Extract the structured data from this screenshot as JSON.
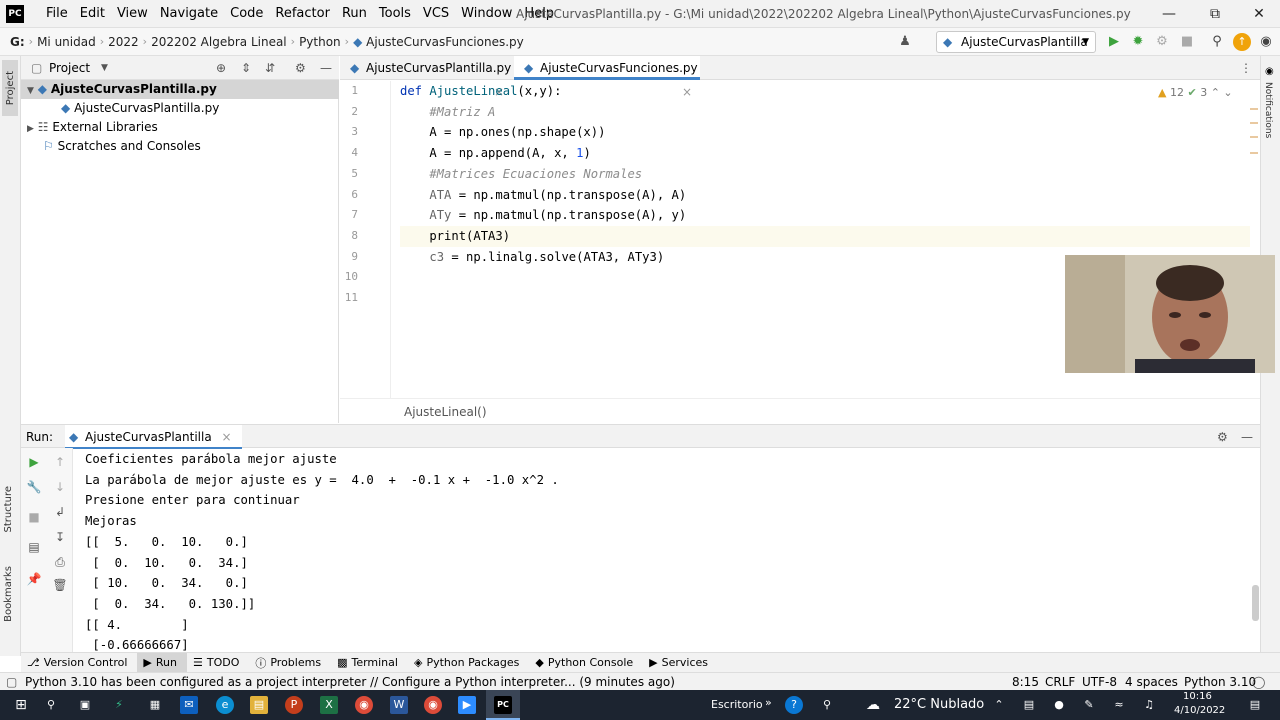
{
  "titlebar": {
    "menu": [
      "File",
      "Edit",
      "View",
      "Navigate",
      "Code",
      "Refactor",
      "Run",
      "Tools",
      "VCS",
      "Window",
      "Help"
    ],
    "title": "AjusteCurvasPlantilla.py - G:\\Mi unidad\\2022\\202202 Algebra Lineal\\Python\\AjusteCurvasFunciones.py"
  },
  "navbar": {
    "crumbs": [
      "G:",
      "Mi unidad",
      "2022",
      "202202 Algebra Lineal",
      "Python",
      "AjusteCurvasFunciones.py"
    ],
    "run_config": "AjusteCurvasPlantilla"
  },
  "project": {
    "header": "Project",
    "items": [
      "AjusteCurvasPlantilla.py",
      "AjusteCurvasPlantilla.py",
      "External Libraries",
      "Scratches and Consoles"
    ]
  },
  "left_strip": {
    "project": "Project",
    "structure": "Structure",
    "bookmarks": "Bookmarks"
  },
  "right_strip": {
    "notifications": "Notifications"
  },
  "editor": {
    "tabs": [
      "AjusteCurvasPlantilla.py",
      "AjusteCurvasFunciones.py"
    ],
    "warnings": "12",
    "weak_warnings": "3",
    "line_numbers": [
      "1",
      "2",
      "3",
      "4",
      "5",
      "6",
      "7",
      "8",
      "9",
      "10",
      "11"
    ],
    "breadcrumb": "AjusteLineal()"
  },
  "run": {
    "label": "Run:",
    "config": "AjusteCurvasPlantilla",
    "output": [
      "Coeficientes parábola mejor ajuste",
      "La parábola de mejor ajuste es y =  4.0  +  -0.1 x +  -1.0 x^2 .",
      "Presione enter para continuar",
      "Mejoras",
      "[[  5.   0.  10.   0.]",
      " [  0.  10.   0.  34.]",
      " [ 10.   0.  34.   0.]",
      " [  0.  34.   0. 130.]]",
      "[[ 4.        ]",
      " [-0.66666667]"
    ]
  },
  "bottom_tabs": [
    "Version Control",
    "Run",
    "TODO",
    "Problems",
    "Terminal",
    "Python Packages",
    "Python Console",
    "Services"
  ],
  "status": {
    "message": "Python 3.10 has been configured as a project interpreter // Configure a Python interpreter... (9 minutes ago)",
    "position": "8:15",
    "line_sep": "CRLF",
    "encoding": "UTF-8",
    "indent": "4 spaces",
    "interpreter": "Python 3.10"
  },
  "taskbar": {
    "escritorio": "Escritorio",
    "weather": "22°C  Nublado",
    "time": "10:16",
    "date": "4/10/2022"
  }
}
